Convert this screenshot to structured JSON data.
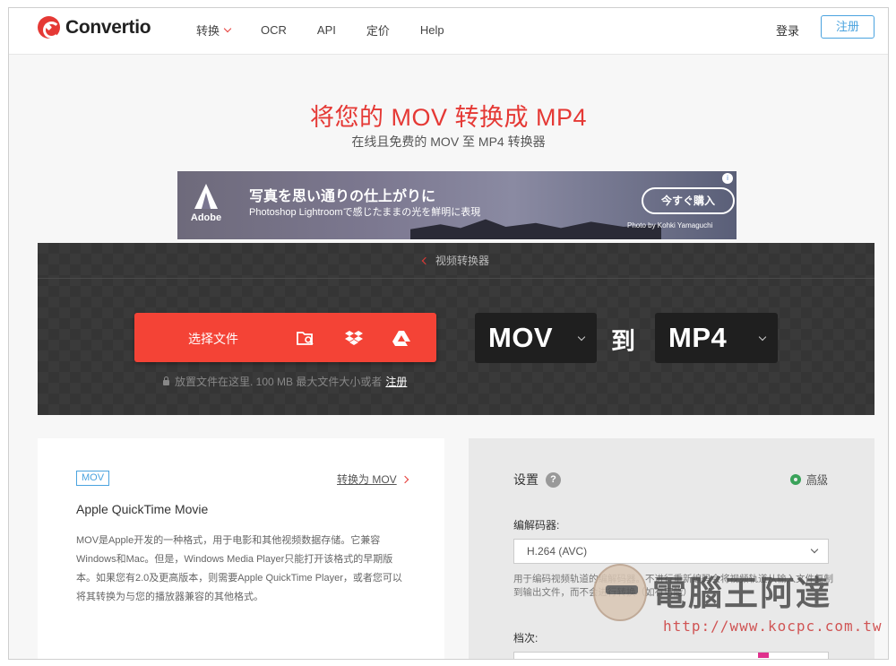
{
  "header": {
    "logo_text": "Convertio",
    "nav": [
      "转换",
      "OCR",
      "API",
      "定价",
      "Help"
    ],
    "login": "登录",
    "signup": "注册"
  },
  "hero": {
    "title": "将您的 MOV 转换成 MP4",
    "subtitle": "在线且免费的 MOV 至 MP4 转换器"
  },
  "ad": {
    "brand": "Adobe",
    "headline": "写真を思い通りの仕上がりに",
    "copy": "Photoshop Lightroomで感じたままの光を鮮明に表現",
    "cta": "今すぐ購入",
    "credit": "Photo by Kohki Yamaguchi"
  },
  "converter": {
    "back_label": "视频转换器",
    "choose_label": "选择文件",
    "hint_text": "放置文件在这里. 100 MB 最大文件大小或者",
    "hint_link": "注册",
    "from_format": "MOV",
    "to_word": "到",
    "to_format": "MP4",
    "source_icons": [
      "folder-search-icon",
      "dropbox-icon",
      "google-drive-icon"
    ]
  },
  "format_info": {
    "tag": "MOV",
    "convert_link": "转换为 MOV",
    "name": "Apple QuickTime Movie",
    "description": "MOV是Apple开发的一种格式，用于电影和其他视频数据存储。它兼容Windows和Mac。但是，Windows Media Player只能打开该格式的早期版本。如果您有2.0及更高版本，则需要Apple QuickTime Player，或者您可以将其转换为与您的播放器兼容的其他格式。"
  },
  "settings": {
    "title": "设置",
    "help": "?",
    "advanced": "高级",
    "codec_label": "编解码器:",
    "codec_value": "H.264 (AVC)",
    "codec_help": "用于编码视频轨道的编解码器。不进行重新编码会将视频轨道从输入文件复制到输出文件，而不会进行转换（如有可能）",
    "level_label": "档次:"
  },
  "watermark": {
    "title": "電腦王阿達",
    "url": "http://www.kocpc.com.tw"
  },
  "colors": {
    "brand_red": "#f44336",
    "link_blue": "#4aa3df",
    "dark_band": "#3a3a3a"
  }
}
